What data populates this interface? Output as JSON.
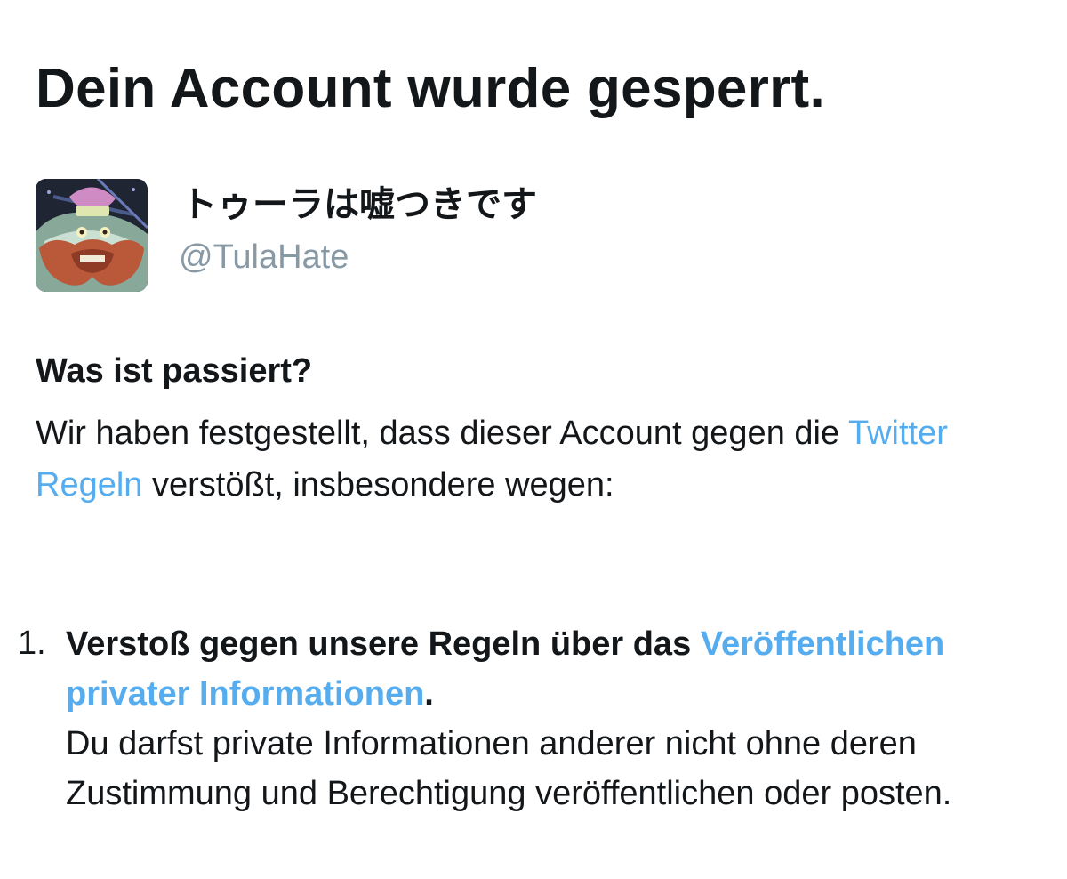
{
  "page": {
    "title": "Dein Account wurde gesperrt."
  },
  "profile": {
    "display_name": "トゥーラは嘘つきです",
    "handle": "@TulaHate",
    "avatar": {
      "icon": "cartoon-bearded-face-avatar"
    }
  },
  "section": {
    "heading": "Was ist passiert?",
    "body_before_link": "Wir haben festgestellt, dass dieser Account gegen die ",
    "body_link": "Twitter Regeln",
    "body_after_link": " verstößt, insbesondere wegen:"
  },
  "violations": [
    {
      "number": "1.",
      "title_before_link": "Verstoß gegen unsere Regeln über das ",
      "title_link": "Veröffentlichen privater Informationen",
      "title_after_link": ".",
      "description": "Du darfst private Informationen anderer nicht ohne deren Zustimmung und Berechtigung veröffentlichen oder posten."
    }
  ],
  "colors": {
    "text": "#14171a",
    "link": "#55acee",
    "muted": "#8899a6",
    "background": "#ffffff"
  }
}
